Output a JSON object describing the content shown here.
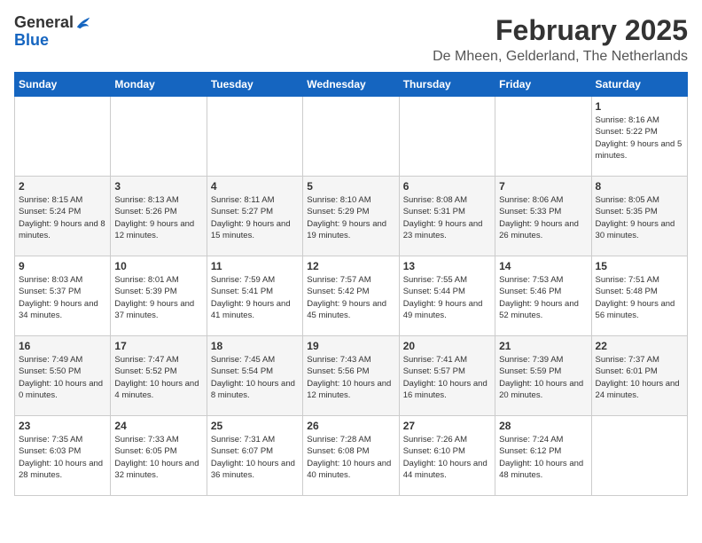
{
  "logo": {
    "general": "General",
    "blue": "Blue"
  },
  "title": "February 2025",
  "subtitle": "De Mheen, Gelderland, The Netherlands",
  "days_of_week": [
    "Sunday",
    "Monday",
    "Tuesday",
    "Wednesday",
    "Thursday",
    "Friday",
    "Saturday"
  ],
  "weeks": [
    [
      {
        "day": "",
        "info": ""
      },
      {
        "day": "",
        "info": ""
      },
      {
        "day": "",
        "info": ""
      },
      {
        "day": "",
        "info": ""
      },
      {
        "day": "",
        "info": ""
      },
      {
        "day": "",
        "info": ""
      },
      {
        "day": "1",
        "info": "Sunrise: 8:16 AM\nSunset: 5:22 PM\nDaylight: 9 hours and 5 minutes."
      }
    ],
    [
      {
        "day": "2",
        "info": "Sunrise: 8:15 AM\nSunset: 5:24 PM\nDaylight: 9 hours and 8 minutes."
      },
      {
        "day": "3",
        "info": "Sunrise: 8:13 AM\nSunset: 5:26 PM\nDaylight: 9 hours and 12 minutes."
      },
      {
        "day": "4",
        "info": "Sunrise: 8:11 AM\nSunset: 5:27 PM\nDaylight: 9 hours and 15 minutes."
      },
      {
        "day": "5",
        "info": "Sunrise: 8:10 AM\nSunset: 5:29 PM\nDaylight: 9 hours and 19 minutes."
      },
      {
        "day": "6",
        "info": "Sunrise: 8:08 AM\nSunset: 5:31 PM\nDaylight: 9 hours and 23 minutes."
      },
      {
        "day": "7",
        "info": "Sunrise: 8:06 AM\nSunset: 5:33 PM\nDaylight: 9 hours and 26 minutes."
      },
      {
        "day": "8",
        "info": "Sunrise: 8:05 AM\nSunset: 5:35 PM\nDaylight: 9 hours and 30 minutes."
      }
    ],
    [
      {
        "day": "9",
        "info": "Sunrise: 8:03 AM\nSunset: 5:37 PM\nDaylight: 9 hours and 34 minutes."
      },
      {
        "day": "10",
        "info": "Sunrise: 8:01 AM\nSunset: 5:39 PM\nDaylight: 9 hours and 37 minutes."
      },
      {
        "day": "11",
        "info": "Sunrise: 7:59 AM\nSunset: 5:41 PM\nDaylight: 9 hours and 41 minutes."
      },
      {
        "day": "12",
        "info": "Sunrise: 7:57 AM\nSunset: 5:42 PM\nDaylight: 9 hours and 45 minutes."
      },
      {
        "day": "13",
        "info": "Sunrise: 7:55 AM\nSunset: 5:44 PM\nDaylight: 9 hours and 49 minutes."
      },
      {
        "day": "14",
        "info": "Sunrise: 7:53 AM\nSunset: 5:46 PM\nDaylight: 9 hours and 52 minutes."
      },
      {
        "day": "15",
        "info": "Sunrise: 7:51 AM\nSunset: 5:48 PM\nDaylight: 9 hours and 56 minutes."
      }
    ],
    [
      {
        "day": "16",
        "info": "Sunrise: 7:49 AM\nSunset: 5:50 PM\nDaylight: 10 hours and 0 minutes."
      },
      {
        "day": "17",
        "info": "Sunrise: 7:47 AM\nSunset: 5:52 PM\nDaylight: 10 hours and 4 minutes."
      },
      {
        "day": "18",
        "info": "Sunrise: 7:45 AM\nSunset: 5:54 PM\nDaylight: 10 hours and 8 minutes."
      },
      {
        "day": "19",
        "info": "Sunrise: 7:43 AM\nSunset: 5:56 PM\nDaylight: 10 hours and 12 minutes."
      },
      {
        "day": "20",
        "info": "Sunrise: 7:41 AM\nSunset: 5:57 PM\nDaylight: 10 hours and 16 minutes."
      },
      {
        "day": "21",
        "info": "Sunrise: 7:39 AM\nSunset: 5:59 PM\nDaylight: 10 hours and 20 minutes."
      },
      {
        "day": "22",
        "info": "Sunrise: 7:37 AM\nSunset: 6:01 PM\nDaylight: 10 hours and 24 minutes."
      }
    ],
    [
      {
        "day": "23",
        "info": "Sunrise: 7:35 AM\nSunset: 6:03 PM\nDaylight: 10 hours and 28 minutes."
      },
      {
        "day": "24",
        "info": "Sunrise: 7:33 AM\nSunset: 6:05 PM\nDaylight: 10 hours and 32 minutes."
      },
      {
        "day": "25",
        "info": "Sunrise: 7:31 AM\nSunset: 6:07 PM\nDaylight: 10 hours and 36 minutes."
      },
      {
        "day": "26",
        "info": "Sunrise: 7:28 AM\nSunset: 6:08 PM\nDaylight: 10 hours and 40 minutes."
      },
      {
        "day": "27",
        "info": "Sunrise: 7:26 AM\nSunset: 6:10 PM\nDaylight: 10 hours and 44 minutes."
      },
      {
        "day": "28",
        "info": "Sunrise: 7:24 AM\nSunset: 6:12 PM\nDaylight: 10 hours and 48 minutes."
      },
      {
        "day": "",
        "info": ""
      }
    ]
  ]
}
